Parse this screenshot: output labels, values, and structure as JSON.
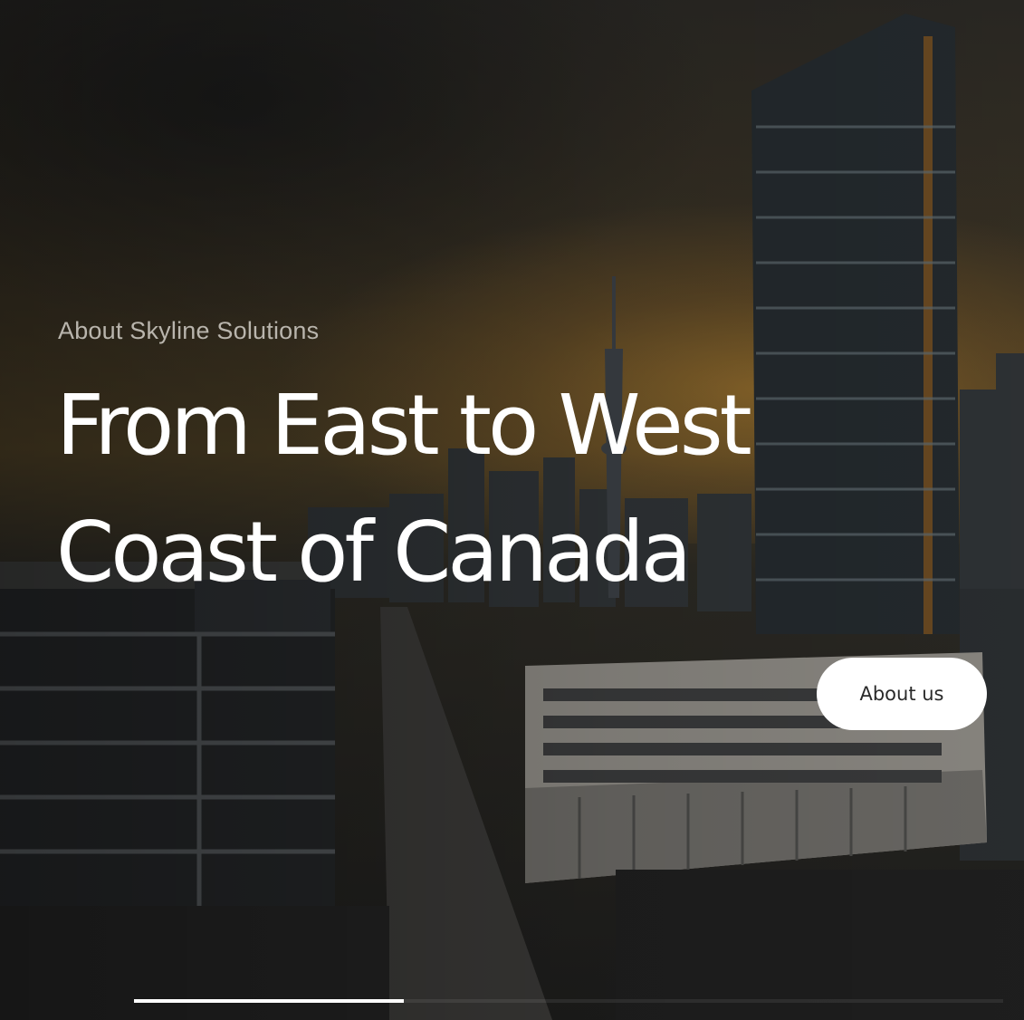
{
  "hero": {
    "eyebrow": "About Skyline Solutions",
    "headline_line1": "From East to West",
    "headline_line2": "Coast of Canada",
    "cta_label": "About us"
  },
  "slider": {
    "progress": 0.31
  },
  "colors": {
    "text": "#ffffff",
    "eyebrow": "#b9b5ad",
    "button_bg": "#ffffff",
    "sky_accent": "#c48c30"
  }
}
